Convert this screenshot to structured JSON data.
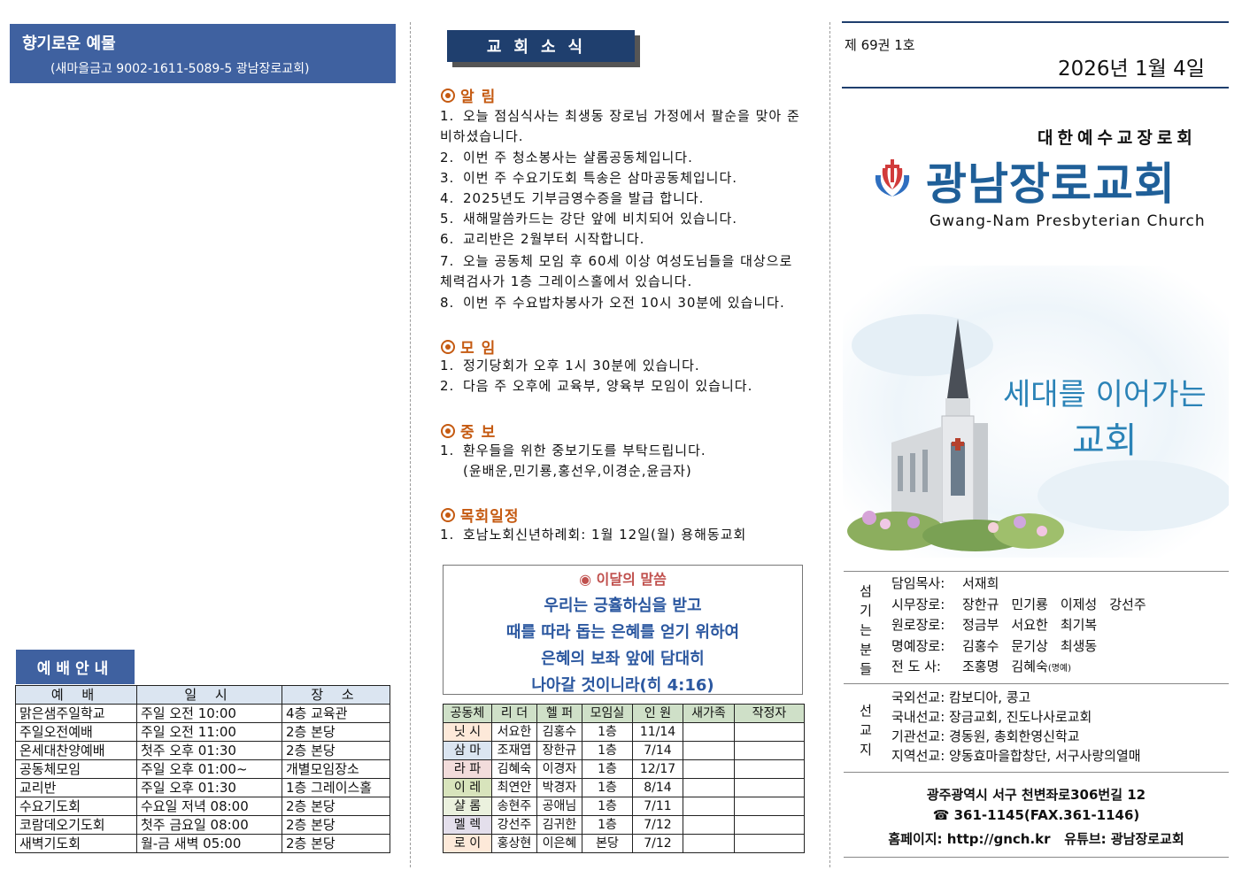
{
  "offering": {
    "title": "향기로운 예물",
    "account": "(새마을금고 9002-1611-5089-5 광남장로교회)"
  },
  "worship": {
    "title": "예배안내",
    "headers": [
      "예 배",
      "일 시",
      "장 소"
    ],
    "rows": [
      [
        "맑은샘주일학교",
        "주일 오전 10:00",
        "4층 교육관"
      ],
      [
        "주일오전예배",
        "주일 오전 11:00",
        "2층 본당"
      ],
      [
        "온세대찬양예배",
        "첫주 오후 01:30",
        "2층 본당"
      ],
      [
        "공동체모임",
        "주일 오후 01:00~",
        "개별모임장소"
      ],
      [
        "교리반",
        "주일 오후 01:30",
        "1층 그레이스홀"
      ],
      [
        "수요기도회",
        "수요일 저녁 08:00",
        "2층 본당"
      ],
      [
        "코람데오기도회",
        "첫주 금요일 08:00",
        "2층 본당"
      ],
      [
        "새벽기도회",
        "월-금 새벽 05:00",
        "2층 본당"
      ]
    ]
  },
  "news": {
    "title": "교회소식",
    "announce_title": "알림",
    "announcements": [
      "오늘 점심식사는 최생동 장로님 가정에서 팔순을 맞아 준비하셨습니다.",
      "이번 주 청소봉사는 샬롬공동체입니다.",
      "이번 주 수요기도회 특송은 삼마공동체입니다.",
      "2025년도 기부금영수증을 발급 합니다.",
      "새해말씀카드는 강단 앞에 비치되어 있습니다.",
      "교리반은 2월부터 시작합니다.",
      "오늘 공동체 모임 후 60세 이상 여성도님들을 대상으로 체력검사가 1층 그레이스홀에서 있습니다.",
      "이번 주 수요밥차봉사가 오전 10시 30분에 있습니다."
    ],
    "meeting_title": "모임",
    "meetings": [
      "정기당회가 오후 1시 30분에 있습니다.",
      "다음 주 오후에 교육부, 양육부 모임이 있습니다."
    ],
    "prayer_title": "중보",
    "prayers": [
      "환우들을 위한 중보기도를 부탁드립니다."
    ],
    "prayer_names": "(윤배운,민기룡,홍선우,이경순,윤금자)",
    "presbytery_title": "목회일정",
    "presbytery": [
      "호남노회신년하례회: 1월 12일(월) 용해동교회"
    ]
  },
  "verse": {
    "title": "이달의 말씀",
    "lines": [
      "우리는 긍휼하심을 받고",
      "때를 따라 돕는 은혜를 얻기 위하여",
      "은혜의 보좌 앞에 담대히",
      "나아갈 것이니라(히 4:16)"
    ]
  },
  "groups": {
    "headers": [
      "공동체",
      "리 더",
      "헬 퍼",
      "모임실",
      "인 원",
      "새가족",
      "작정자"
    ],
    "rows": [
      {
        "name": "닛 시",
        "leader": "서요한",
        "helper": "김홍수",
        "room": "1층",
        "count": "11/14",
        "color": "#fde9d9"
      },
      {
        "name": "삼 마",
        "leader": "조재엽",
        "helper": "장한규",
        "room": "1층",
        "count": "7/14",
        "color": "#dbe5f1"
      },
      {
        "name": "라 파",
        "leader": "김혜숙",
        "helper": "이경자",
        "room": "1층",
        "count": "12/17",
        "color": "#f2dcdb"
      },
      {
        "name": "이 레",
        "leader": "최연안",
        "helper": "박경자",
        "room": "1층",
        "count": "8/14",
        "color": "#d8e4bc"
      },
      {
        "name": "샬 롬",
        "leader": "송현주",
        "helper": "공애님",
        "room": "1층",
        "count": "7/11",
        "color": "#ebf1de"
      },
      {
        "name": "멜 렉",
        "leader": "강선주",
        "helper": "김귀한",
        "room": "1층",
        "count": "7/12",
        "color": "#e4dfec"
      },
      {
        "name": "로 이",
        "leader": "홍상현",
        "helper": "이은혜",
        "room": "본당",
        "count": "7/12",
        "color": "#fde9d9"
      }
    ]
  },
  "header": {
    "issue": "제 69권 1호",
    "date": "2026년 1월 4일",
    "denomination": "대한예수교장로회",
    "church_name": "광남장로교회",
    "church_en": "Gwang-Nam Presbyterian Church"
  },
  "slogan": {
    "line1": "세대를 이어가는",
    "line2": "교회"
  },
  "staff": {
    "label": "섬기는분들",
    "rows": [
      {
        "role": "담임목사:",
        "names": [
          "서재희"
        ]
      },
      {
        "role": "시무장로:",
        "names": [
          "장한규",
          "민기룡",
          "이제성",
          "강선주"
        ]
      },
      {
        "role": "원로장로:",
        "names": [
          "정금부",
          "서요한",
          "최기복"
        ]
      },
      {
        "role": "명예장로:",
        "names": [
          "김홍수",
          "문기상",
          "최생동"
        ]
      },
      {
        "role": "전 도 사:",
        "names": [
          "조홍명",
          "김혜숙"
        ],
        "note": "(명예)"
      }
    ]
  },
  "mission": {
    "label": "선교지",
    "rows": [
      "국외선교: 캄보디아, 콩고",
      "국내선교: 장금교회, 진도나사로교회",
      "기관선교: 경동원, 총회한영신학교",
      "지역선교: 양동효마을합창단, 서구사랑의열매"
    ]
  },
  "contact": {
    "address": "광주광역시 서구 천변좌로306번길 12",
    "phone": "☎ 361-1145(FAX.361-1146)",
    "web": "홈페이지: http://gnch.kr   유튜브: 광남장로교회"
  },
  "colors": {
    "navy": "#1f3f6e",
    "blue": "#3f61a0",
    "orange": "#c55a11",
    "verse_blue": "#2c58a0"
  }
}
